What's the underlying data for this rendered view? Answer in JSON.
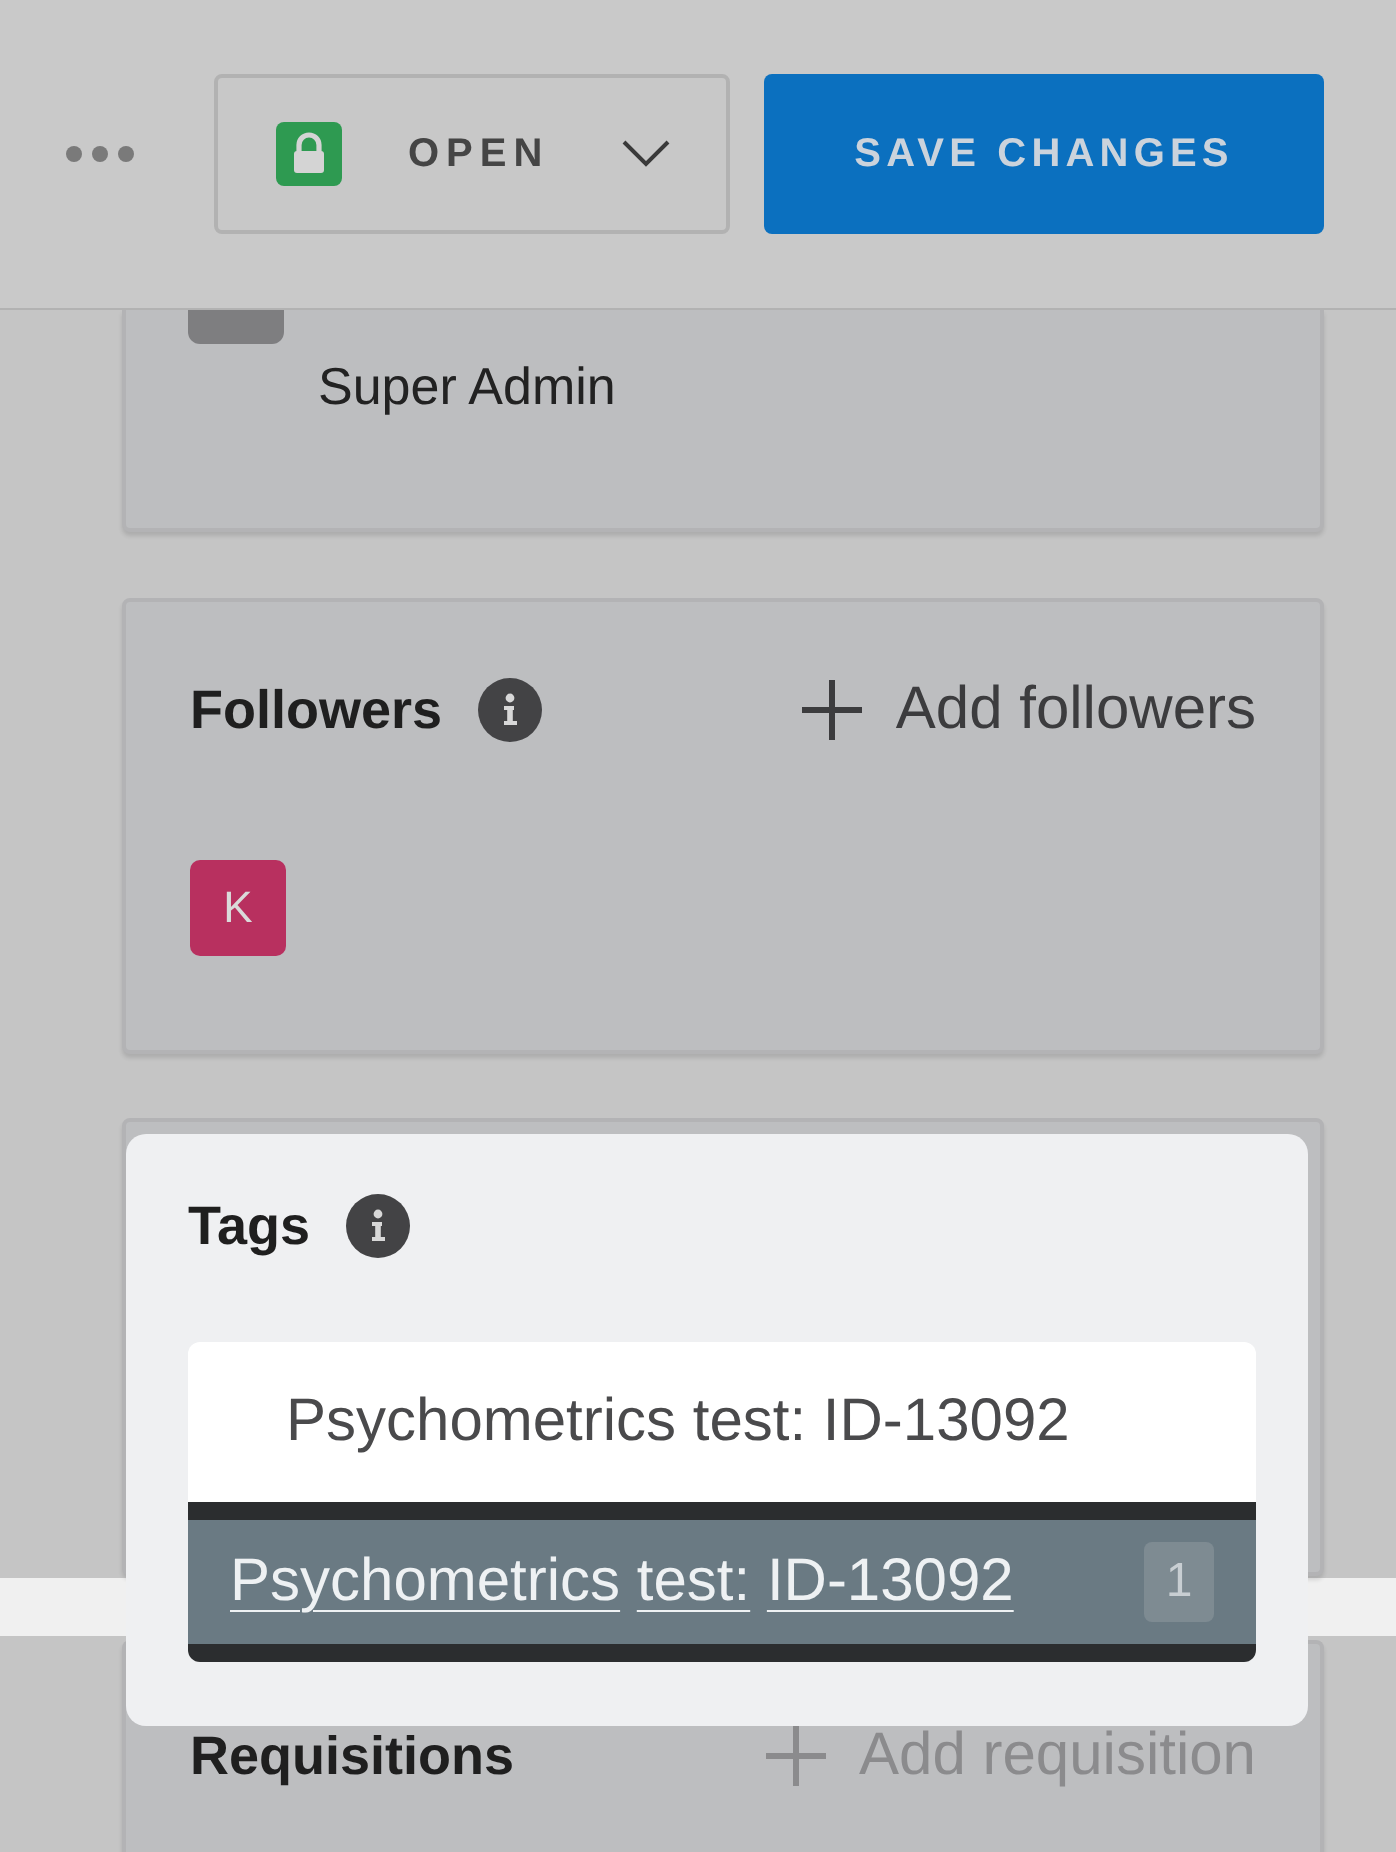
{
  "header": {
    "status_dropdown": {
      "label": "OPEN"
    },
    "save_button": {
      "label": "SAVE CHANGES"
    }
  },
  "access_card": {
    "role": "Super Admin"
  },
  "followers": {
    "title": "Followers",
    "action": {
      "label": "Add followers",
      "disabled": false
    },
    "avatars": [
      {
        "initial": "K",
        "color": "#b8305f"
      }
    ]
  },
  "tags": {
    "title": "Tags",
    "input": {
      "value": "Psychometrics test: ID-13092"
    },
    "suggestions": [
      {
        "label": "Psychometrics test: ID-13092",
        "count": "1",
        "selected": true
      }
    ]
  },
  "requisitions": {
    "title": "Requisitions",
    "action": {
      "label": "Add requisition",
      "disabled": true
    }
  }
}
